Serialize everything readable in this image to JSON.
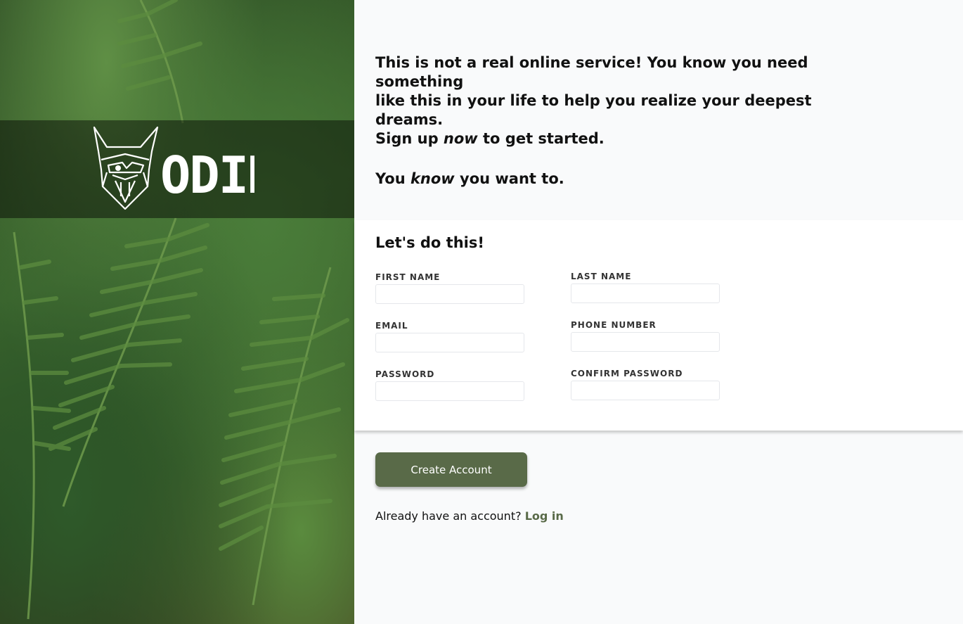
{
  "brand": {
    "logo_text": "ODIN",
    "logo_icon": "viking-head-icon"
  },
  "intro": {
    "line1": "This is not a real online service! You know you need something",
    "line2": "like this in your life to help you realize your deepest dreams.",
    "line3_a": "Sign up ",
    "line3_em": "now",
    "line3_b": " to get started.",
    "line4_a": "You ",
    "line4_em": "know",
    "line4_b": " you want to."
  },
  "form": {
    "heading": "Let's do this!",
    "first_name_label": "FIRST NAME",
    "last_name_label": "LAST NAME",
    "email_label": "EMAIL",
    "phone_label": "PHONE NUMBER",
    "password_label": "PASSWORD",
    "confirm_password_label": "CONFIRM PASSWORD"
  },
  "actions": {
    "create_account": "Create Account",
    "have_account": "Already have an account?",
    "login": "Log in"
  },
  "colors": {
    "accent": "#596a48",
    "page_bg": "#f9fafb"
  }
}
